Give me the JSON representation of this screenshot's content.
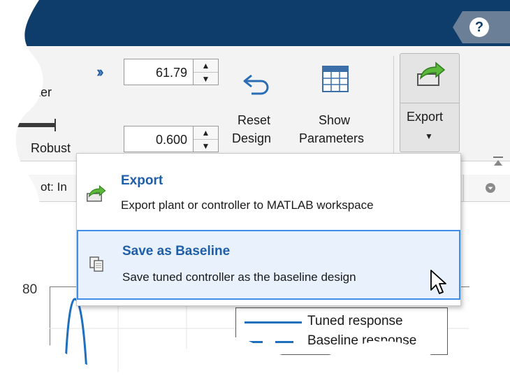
{
  "header": {
    "help_label": "?"
  },
  "toolstrip": {
    "partial_left_label": "ster",
    "robust_label": "Robust",
    "spinner1_value": "61.79",
    "spinner2_value": "0.600",
    "reset_design_label": [
      "Reset",
      "Design"
    ],
    "show_parameters_label": [
      "Show",
      "Parameters"
    ],
    "export_label": "Export"
  },
  "tab_row": {
    "partial_tab": "ot: In"
  },
  "export_menu": {
    "items": [
      {
        "title": "Export",
        "description": "Export plant or controller to MATLAB workspace"
      },
      {
        "title": "Save as Baseline",
        "description": "Save tuned controller as the baseline design"
      }
    ]
  },
  "plot": {
    "ytick_partial": "80",
    "legend": [
      {
        "label": "Tuned response",
        "color": "#1f6fbf",
        "style": "solid"
      },
      {
        "label": "Baseline response",
        "color": "#1f6fbf",
        "style": "dashed"
      }
    ]
  },
  "colors": {
    "titlebar": "#0e3d6b",
    "accent": "#1f5ea8",
    "selection_border": "#3d8ee6"
  }
}
